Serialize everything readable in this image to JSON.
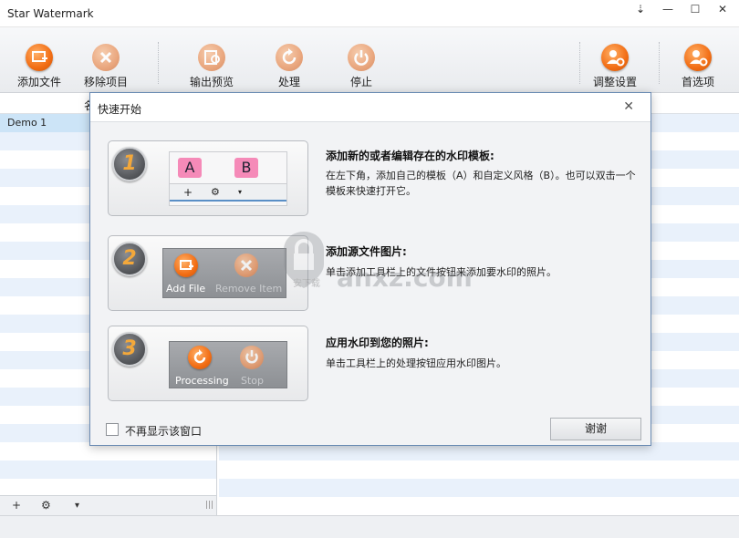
{
  "window": {
    "title": "Star Watermark",
    "controls": [
      "⇣",
      "—",
      "☐",
      "✕"
    ]
  },
  "toolbar": {
    "add_file": "添加文件",
    "remove_item": "移除项目",
    "output_preview": "输出预览",
    "process": "处理",
    "stop": "停止",
    "adjust_settings": "调整设置",
    "preferences": "首选项"
  },
  "left_panel": {
    "header": "名",
    "items": [
      "Demo 1"
    ],
    "bottom_add": "+",
    "bottom_gear": "⚙",
    "bottom_caret": "▾",
    "bottom_grip": "|||"
  },
  "dialog": {
    "title": "快速开始",
    "close": "✕",
    "steps": [
      {
        "number": "1",
        "heading": "添加新的或者编辑存在的水印模板:",
        "text": "在左下角，添加自己的模板（A）和自定义风格（B）。也可以双击一个模板来快速打开它。",
        "mini": {
          "a": "A",
          "b": "B",
          "plus": "+",
          "gear": "⚙",
          "caret": "▾"
        }
      },
      {
        "number": "2",
        "heading": "添加源文件图片:",
        "text": "单击添加工具栏上的文件按钮来添加要水印的照片。",
        "mini": {
          "add": "Add File",
          "remove": "Remove Item"
        }
      },
      {
        "number": "3",
        "heading": "应用水印到您的照片:",
        "text": "单击工具栏上的处理按钮应用水印图片。",
        "mini": {
          "processing": "Processing",
          "stop": "Stop"
        }
      }
    ],
    "dont_show": "不再显示该窗口",
    "ok": "谢谢"
  },
  "watermark": {
    "text": "anxz.com",
    "sub": "安下载"
  },
  "colors": {
    "accent_orange": "#f26d14",
    "selection": "#cce4f7",
    "stripe": "#e9f1fb",
    "dialog_border": "#6a8bb3"
  }
}
